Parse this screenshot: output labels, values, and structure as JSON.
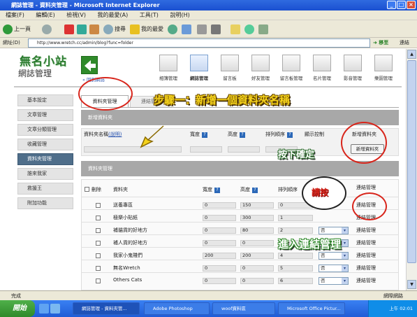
{
  "window": {
    "title": "網誌管理 - 資料夾管理 - Microsoft Internet Explorer"
  },
  "menu": [
    "檔案(F)",
    "編輯(E)",
    "檢視(V)",
    "我的最愛(A)",
    "工具(T)",
    "說明(H)"
  ],
  "toolbar": {
    "back": "上一頁",
    "search": "搜尋",
    "favorites": "我的最愛"
  },
  "address": {
    "label": "網址(D)",
    "url": "http://www.wretch.cc/admin/blog?func=folder",
    "go": "移至",
    "links": "連結"
  },
  "site": {
    "logo": "無名小站",
    "sub": "網誌管理",
    "back_link": "« 回到網誌"
  },
  "nav": [
    "相簿管理",
    "網誌管理",
    "留言板",
    "好友管理",
    "留言板管理",
    "名片管理",
    "影音管理",
    "樂園管理"
  ],
  "sidebar": [
    "基本設定",
    "文章管理",
    "文章分類管理",
    "收藏管理",
    "資料夾管理",
    "誰來我家",
    "救援王",
    "附加功能"
  ],
  "tabs": {
    "active": "資料夾管理",
    "other": "連結管理"
  },
  "new_folder": {
    "section_title": "新增資料夾",
    "col_name": "資料夾名稱",
    "col_name_help": "(說明)",
    "col_width": "寬度",
    "col_height": "高度",
    "col_order": "排列順序",
    "col_display": "顯示控制",
    "col_add": "新增資料夾",
    "add_button": "新增資料夾"
  },
  "folder_mgmt": {
    "section_title": "資料夾管理",
    "col_delete": "刪除",
    "col_folder": "資料夾",
    "col_width": "寬度",
    "col_height": "高度",
    "col_order": "排列順序",
    "col_link": "連結管理",
    "rows": [
      {
        "name": "送養專區",
        "width": "0",
        "height": "150",
        "order": "0",
        "display": "",
        "link": "連結管理"
      },
      {
        "name": "極樂小貼紙",
        "width": "0",
        "height": "300",
        "order": "1",
        "display": "",
        "link": "連結管理"
      },
      {
        "name": "補貓貨的好地方",
        "width": "0",
        "height": "80",
        "order": "2",
        "display": "否",
        "link": "連結管理"
      },
      {
        "name": "補人貨的好地方",
        "width": "0",
        "height": "0",
        "order": "3",
        "display": "否",
        "link": "連結管理"
      },
      {
        "name": "我家小鬼賤們",
        "width": "200",
        "height": "200",
        "order": "4",
        "display": "否",
        "link": "連結管理"
      },
      {
        "name": "無名Wretch",
        "width": "0",
        "height": "0",
        "order": "5",
        "display": "否",
        "link": "連結管理"
      },
      {
        "name": "Others Cats",
        "width": "0",
        "height": "0",
        "order": "6",
        "display": "否",
        "link": "連結管理"
      }
    ]
  },
  "annotations": {
    "step1": "步驟一：新增一個資料夾名稱",
    "press_ok": "按下確定",
    "please_click": "請按",
    "enter_link": "進入連結管理"
  },
  "status": {
    "left": "完成",
    "zone": "網際網路"
  },
  "taskbar": {
    "start": "開始",
    "tasks": [
      "網誌管理 - 資料夾管...",
      "Adobe Photoshop",
      "woof資料區",
      "Microsoft Office Pictur..."
    ],
    "clock": "上午 02:01"
  },
  "colors": {
    "accent_green": "#2a7a2e",
    "annotation_red": "#d8251b",
    "annotation_yellow": "#f4d21c",
    "annotation_green": "#3aa23a",
    "active_side": "#4f6e8a"
  }
}
